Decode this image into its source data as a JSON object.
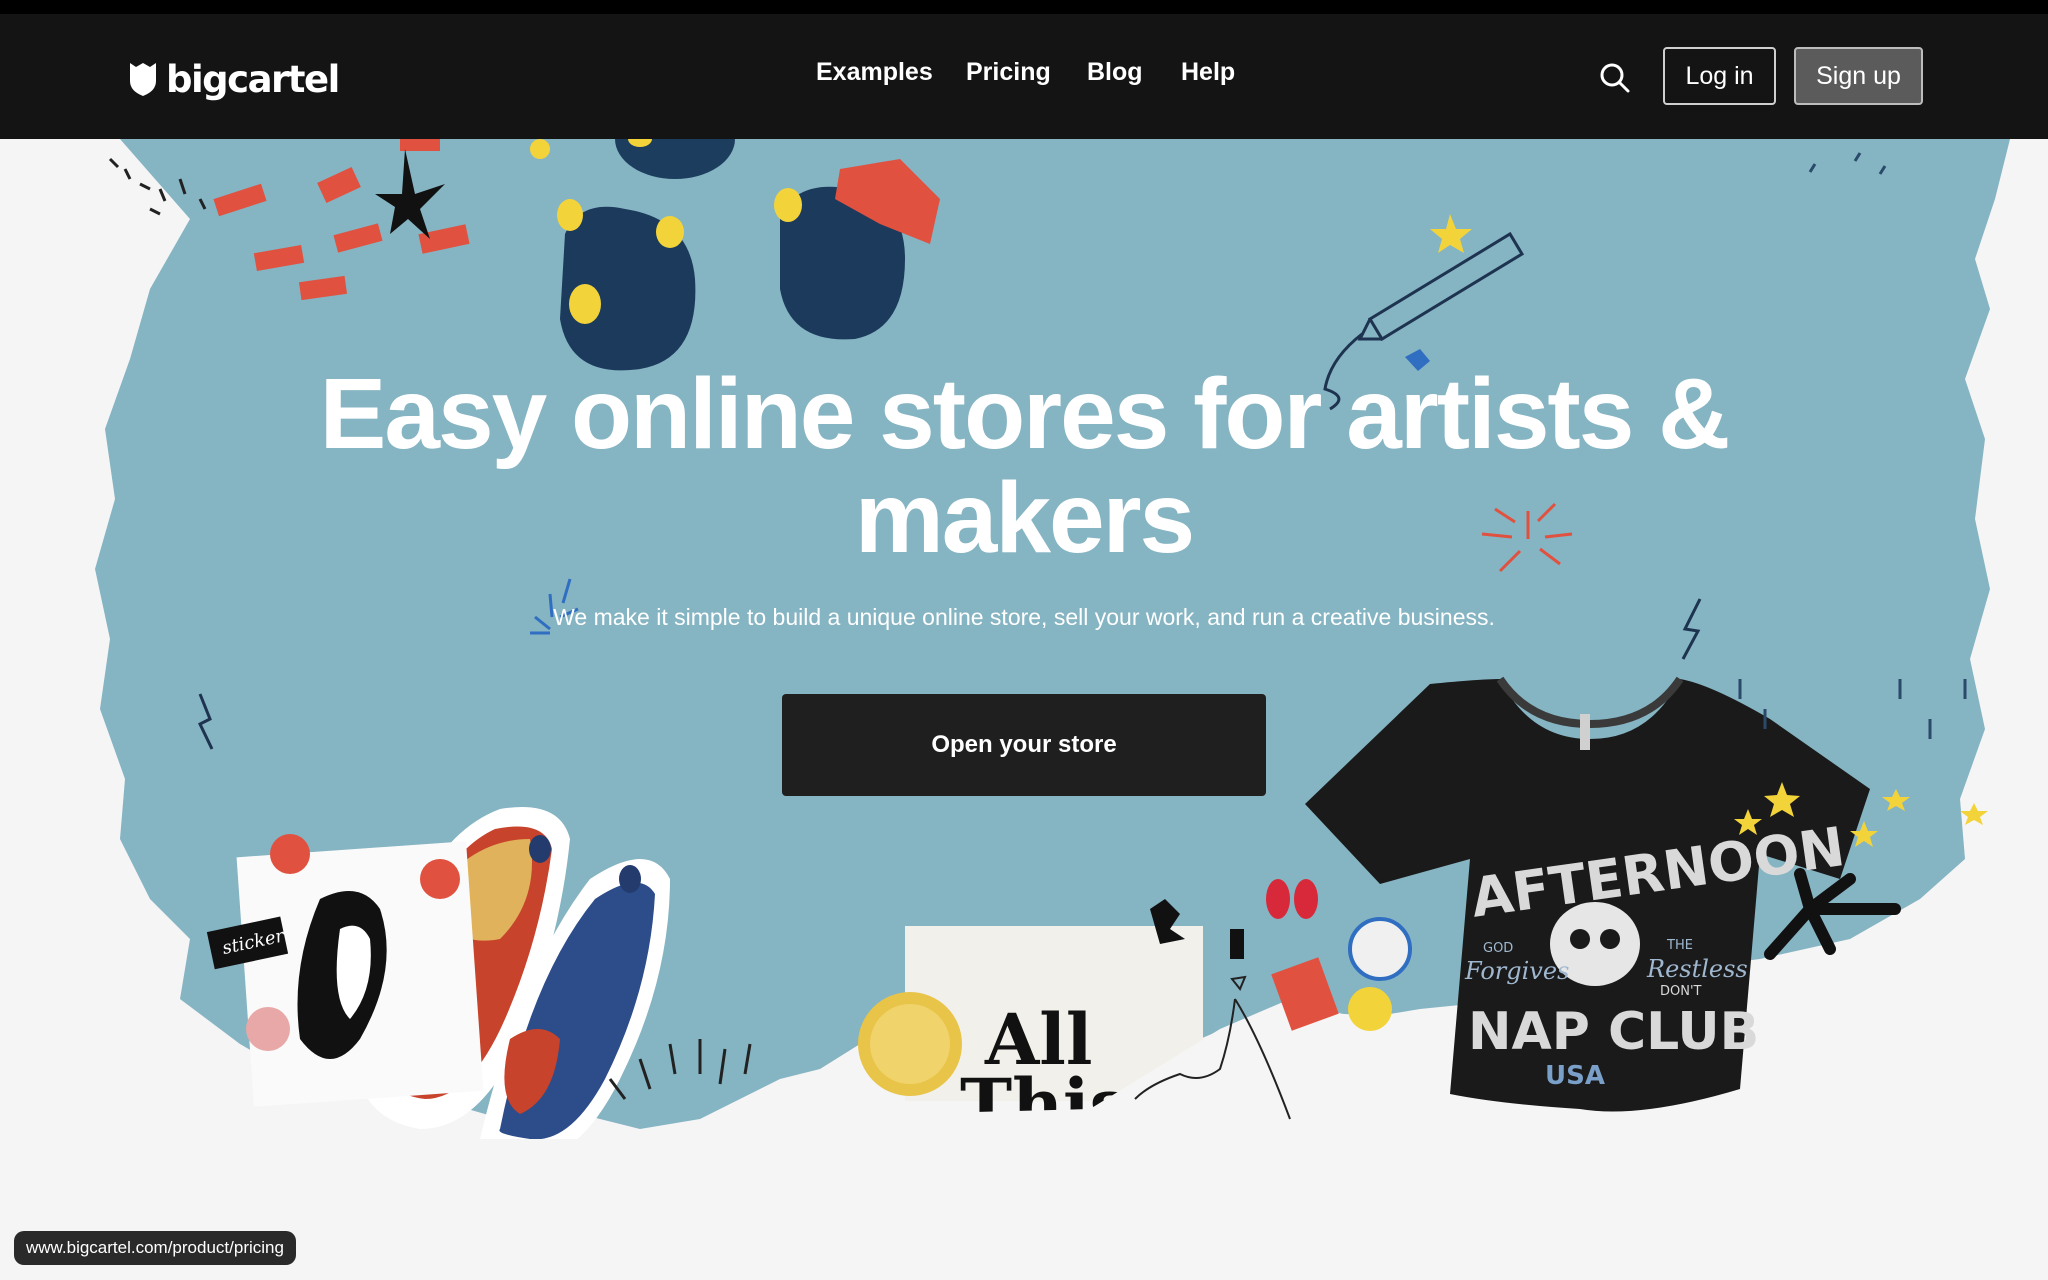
{
  "nav": {
    "logo_text": "bigcartel",
    "links": [
      "Examples",
      "Pricing",
      "Blog",
      "Help"
    ],
    "login_label": "Log in",
    "signup_label": "Sign up"
  },
  "hero": {
    "title_line1": "Easy online stores for artists &",
    "title_line2": "makers",
    "subtitle": "We make it simple to build a unique online store, sell your work, and run a creative business.",
    "cta_label": "Open your store"
  },
  "illustrations": {
    "poster_text_line1": "All",
    "poster_text_line2": "This",
    "tshirt_text_top": "AFTERNOON",
    "tshirt_text_bottom": "NAP CLUB",
    "tshirt_text_country": "USA",
    "tshirt_text_left1": "GOD",
    "tshirt_text_left2": "Forgives",
    "tshirt_text_right1": "THE",
    "tshirt_text_right2": "Restless",
    "tshirt_text_right3": "DON'T",
    "sticker_text": "sticker"
  },
  "status_bar": {
    "url": "www.bigcartel.com/product/pricing"
  },
  "colors": {
    "nav_bg": "#141414",
    "hero_blue": "#85b4c3",
    "cta_bg": "#1f1f1f",
    "page_bg": "#f5f5f5"
  }
}
